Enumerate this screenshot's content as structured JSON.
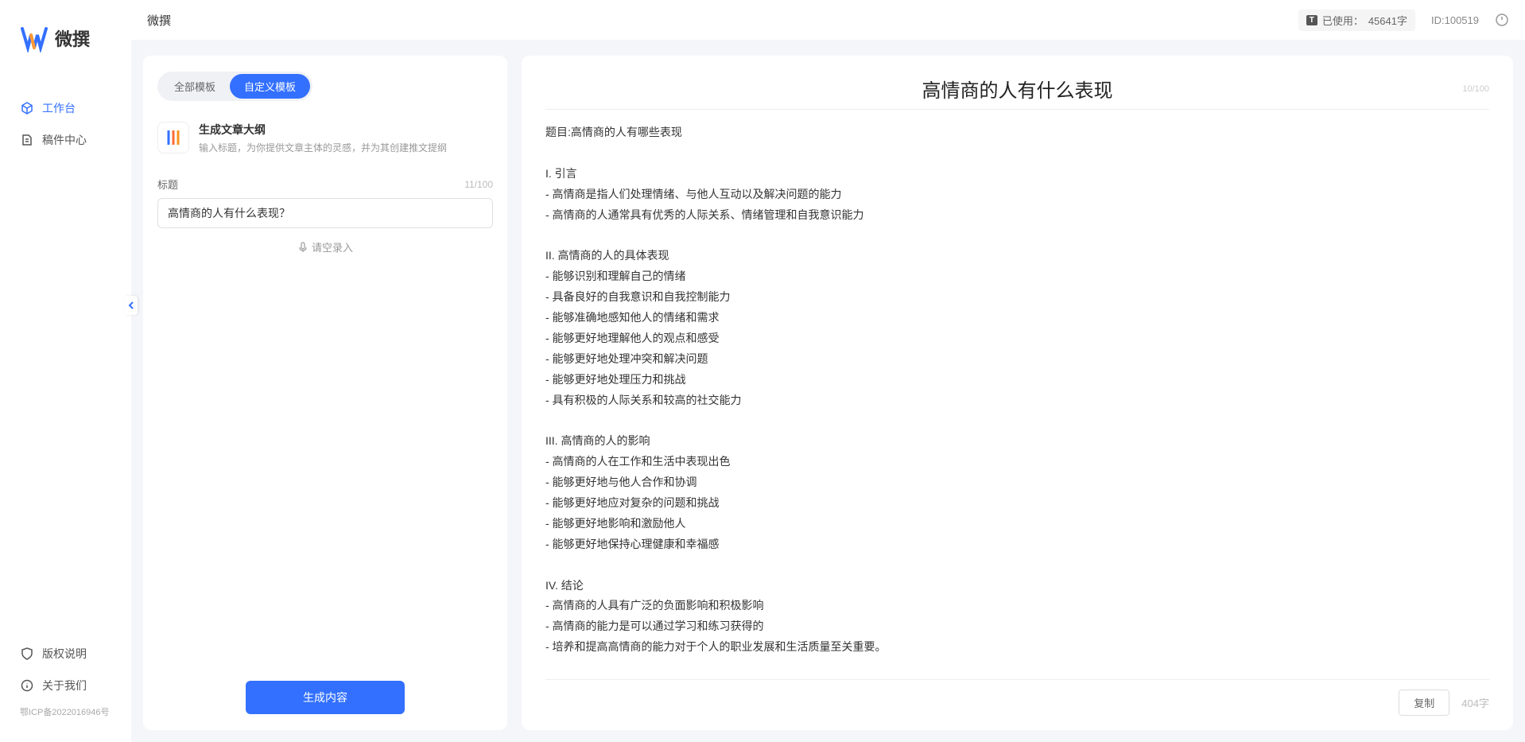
{
  "app": {
    "name": "微撰",
    "logo_text": "微撰"
  },
  "sidebar": {
    "nav": [
      {
        "label": "工作台",
        "icon": "cube"
      },
      {
        "label": "稿件中心",
        "icon": "document"
      }
    ],
    "footer": [
      {
        "label": "版权说明",
        "icon": "shield"
      },
      {
        "label": "关于我们",
        "icon": "info"
      }
    ],
    "icp": "鄂ICP备2022016946号"
  },
  "header": {
    "title": "微撰",
    "usage_label": "已使用：",
    "usage_value": "45641字",
    "user_id_label": "ID:",
    "user_id_value": "100519"
  },
  "leftPanel": {
    "tabs": [
      {
        "label": "全部模板"
      },
      {
        "label": "自定义模板"
      }
    ],
    "template": {
      "title": "生成文章大纲",
      "desc": "输入标题，为你提供文章主体的灵感，并为其创建推文提纲"
    },
    "form": {
      "label": "标题",
      "counter": "11/100",
      "value": "高情商的人有什么表现？",
      "voice_label": "请空录入"
    },
    "button": "生成内容"
  },
  "rightPanel": {
    "title": "高情商的人有什么表现",
    "title_counter": "10/100",
    "body": "题目:高情商的人有哪些表现\n\nI. 引言\n- 高情商是指人们处理情绪、与他人互动以及解决问题的能力\n- 高情商的人通常具有优秀的人际关系、情绪管理和自我意识能力\n\nII. 高情商的人的具体表现\n- 能够识别和理解自己的情绪\n- 具备良好的自我意识和自我控制能力\n- 能够准确地感知他人的情绪和需求\n- 能够更好地理解他人的观点和感受\n- 能够更好地处理冲突和解决问题\n- 能够更好地处理压力和挑战\n- 具有积极的人际关系和较高的社交能力\n\nIII. 高情商的人的影响\n- 高情商的人在工作和生活中表现出色\n- 能够更好地与他人合作和协调\n- 能够更好地应对复杂的问题和挑战\n- 能够更好地影响和激励他人\n- 能够更好地保持心理健康和幸福感\n\nIV. 结论\n- 高情商的人具有广泛的负面影响和积极影响\n- 高情商的能力是可以通过学习和练习获得的\n- 培养和提高高情商的能力对于个人的职业发展和生活质量至关重要。",
    "copy_button": "复制",
    "word_count": "404字"
  }
}
